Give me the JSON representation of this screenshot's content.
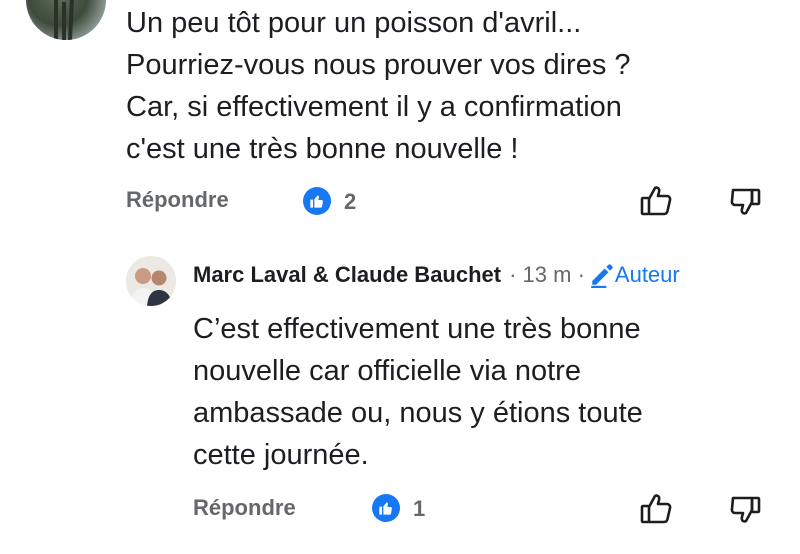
{
  "comment1": {
    "lines": [
      "Un peu tôt pour un poisson d'avril...",
      "Pourriez-vous nous prouver vos dires ?",
      "Car, si effectivement il y a confirmation",
      "c'est une très bonne nouvelle !"
    ],
    "reply_label": "Répondre",
    "like_count": "2",
    "like_icon": "thumbs-up-icon",
    "dislike_icon": "thumbs-down-icon"
  },
  "comment2": {
    "author": "Marc Laval & Claude Bauchet",
    "time": "· 13 m ·",
    "author_badge": "Auteur",
    "lines": [
      "C’est effectivement une très bonne",
      "nouvelle car officielle via notre",
      "ambassade ou, nous y étions toute",
      "cette journée."
    ],
    "reply_label": "Répondre",
    "like_count": "1"
  },
  "colors": {
    "accent": "#1877f2",
    "muted": "#65676b",
    "text": "#1c1e21"
  }
}
